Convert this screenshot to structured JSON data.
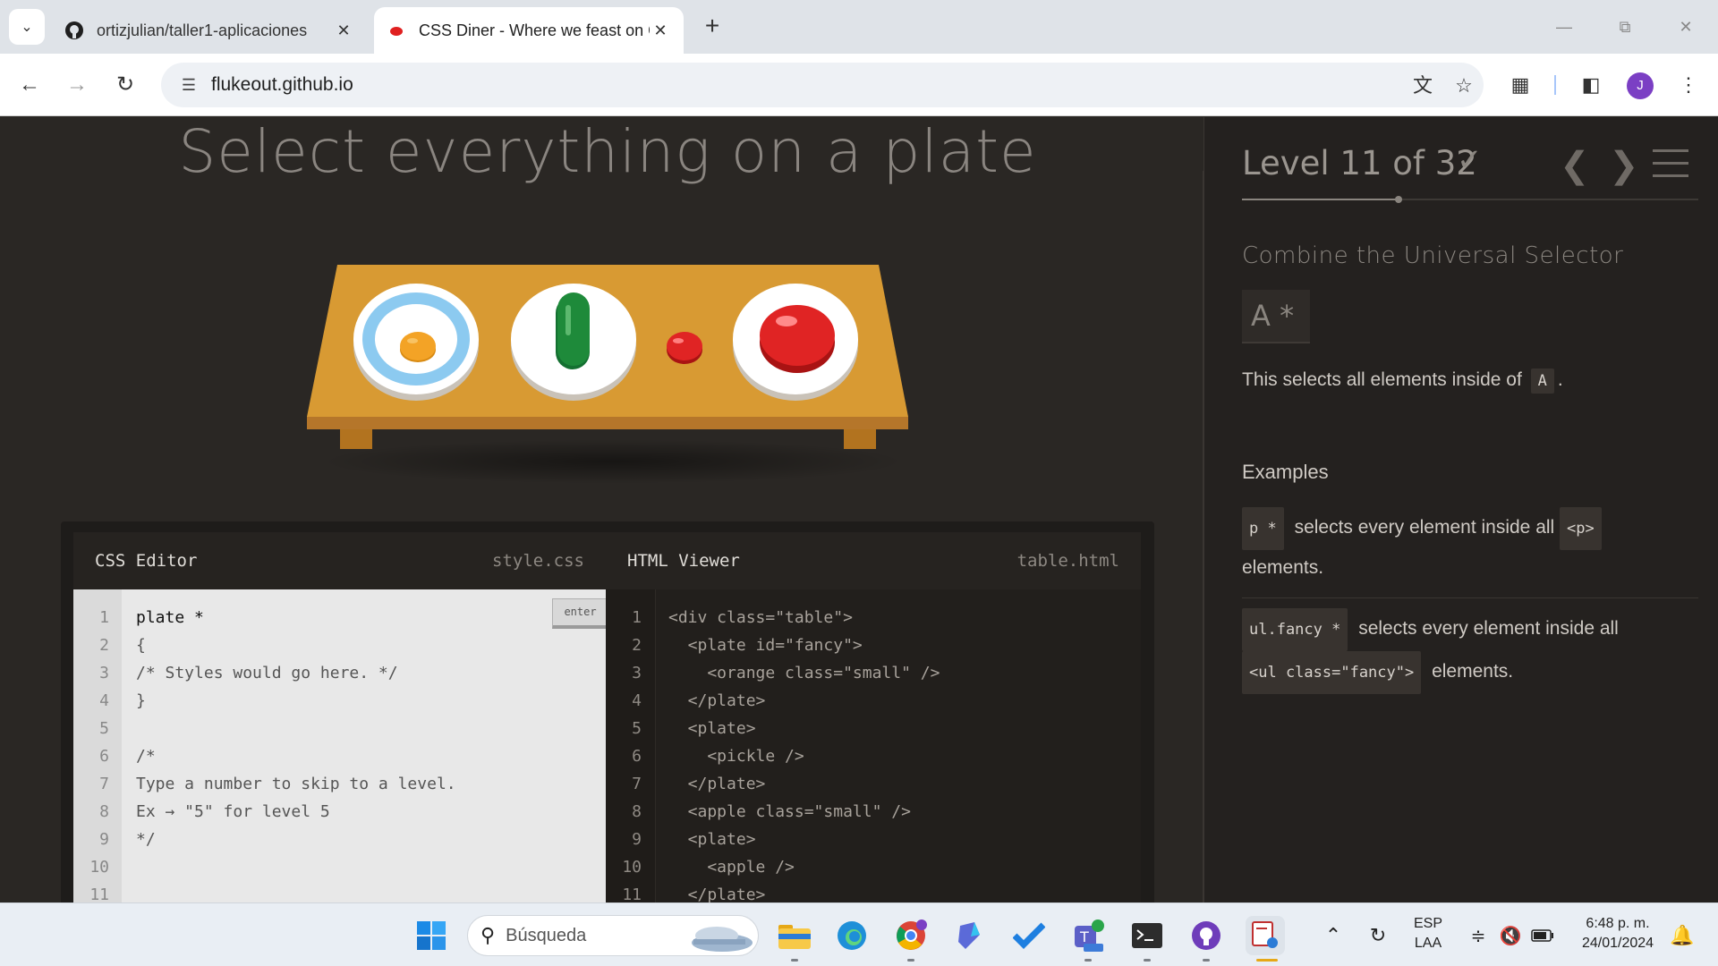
{
  "browser": {
    "tabs": [
      {
        "title": "ortizjulian/taller1-aplicaciones",
        "favicon": "github-icon",
        "active": false
      },
      {
        "title": "CSS Diner - Where we feast on CSS Selectors!",
        "favicon": "red-dot-icon",
        "active": true
      }
    ],
    "url": "flukeout.github.io",
    "profile_initial": "J"
  },
  "game": {
    "instruction": "Select everything on a plate",
    "level_label": "Level 11 of 32",
    "level_current": 11,
    "level_total": 32,
    "selector_name": "Combine the Universal Selector",
    "syntax": "A  *",
    "hint_prefix": "This selects all elements inside of",
    "hint_tag": "A",
    "hint_suffix": ".",
    "examples_title": "Examples",
    "examples": [
      {
        "code": "p  *",
        "text1": "selects every element inside all",
        "tag": "<p>",
        "text2": "elements."
      },
      {
        "code": "ul.fancy  *",
        "text1": "selects every element inside all",
        "tag": "<ul class=\"fancy\">",
        "text2": "elements."
      }
    ]
  },
  "editor": {
    "css_title": "CSS Editor",
    "css_file": "style.css",
    "html_title": "HTML Viewer",
    "html_file": "table.html",
    "enter_label": "enter",
    "css_lines": [
      "plate *",
      "{",
      "/* Styles would go here. */",
      "}",
      "",
      "/*",
      "Type a number to skip to a level.",
      "Ex → \"5\" for level 5",
      "*/",
      "",
      ""
    ],
    "html_lines": [
      "<div class=\"table\">",
      "  <plate id=\"fancy\">",
      "    <orange class=\"small\" />",
      "  </plate>",
      "  <plate>",
      "    <pickle />",
      "  </plate>",
      "  <apple class=\"small\" />",
      "  <plate>",
      "    <apple />",
      "  </plate>"
    ]
  },
  "taskbar": {
    "search_placeholder": "Búsqueda",
    "lang_top": "ESP",
    "lang_bottom": "LAA",
    "time": "6:48 p. m.",
    "date": "24/01/2024"
  },
  "colors": {
    "page_bg": "#2a2724",
    "table": "#d89a33",
    "plate_fancy_rim": "#8ccaf0",
    "orange": "#f0a020",
    "pickle": "#1e8a3a",
    "apple": "#d81c1c"
  }
}
